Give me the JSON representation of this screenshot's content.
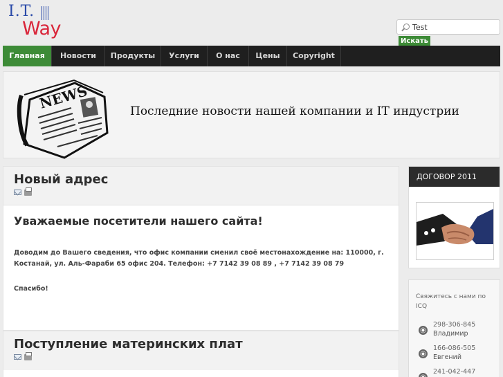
{
  "logo": {
    "line1": "I.T.",
    "line2": "Way"
  },
  "search": {
    "value": "Test",
    "button_label": "Искать"
  },
  "nav": {
    "items": [
      {
        "label": "Главная",
        "active": true
      },
      {
        "label": "Новости"
      },
      {
        "label": "Продукты"
      },
      {
        "label": "Услуги"
      },
      {
        "label": "О нас"
      },
      {
        "label": "Цены"
      },
      {
        "label": "Copyright"
      }
    ]
  },
  "banner": {
    "news_label": "NEWS",
    "slogan": "Последние новости нашей компании и IT индустрии"
  },
  "articles": [
    {
      "title": "Новый адрес",
      "subtitle": "Уважаемые посетители нашего сайта!",
      "paragraph": "Доводим до Вашего сведения, что офис компании сменил своё местонахождение на: 110000, г. Костанай, ул. Аль-Фараби 65 офис 204. Телефон: +7 7142 39 08 89 , +7 7142 39 08 79",
      "thanks": "Спасибо!"
    },
    {
      "title": "Поступление материнских плат"
    }
  ],
  "sidebar": {
    "dogovor_title": "ДОГОВОР 2011",
    "icq_title": "Свяжитесь с нами по ICQ",
    "contacts": [
      {
        "number": "298-306-845",
        "name": "Владимир"
      },
      {
        "number": "166-086-505",
        "name": "Евгений"
      },
      {
        "number": "241-042-447",
        "name": ""
      }
    ]
  },
  "colors": {
    "accent": "#3d8b37",
    "nav_bg": "#1f1f1f",
    "logo_blue": "#2a4aa8",
    "logo_red": "#d9263a"
  }
}
